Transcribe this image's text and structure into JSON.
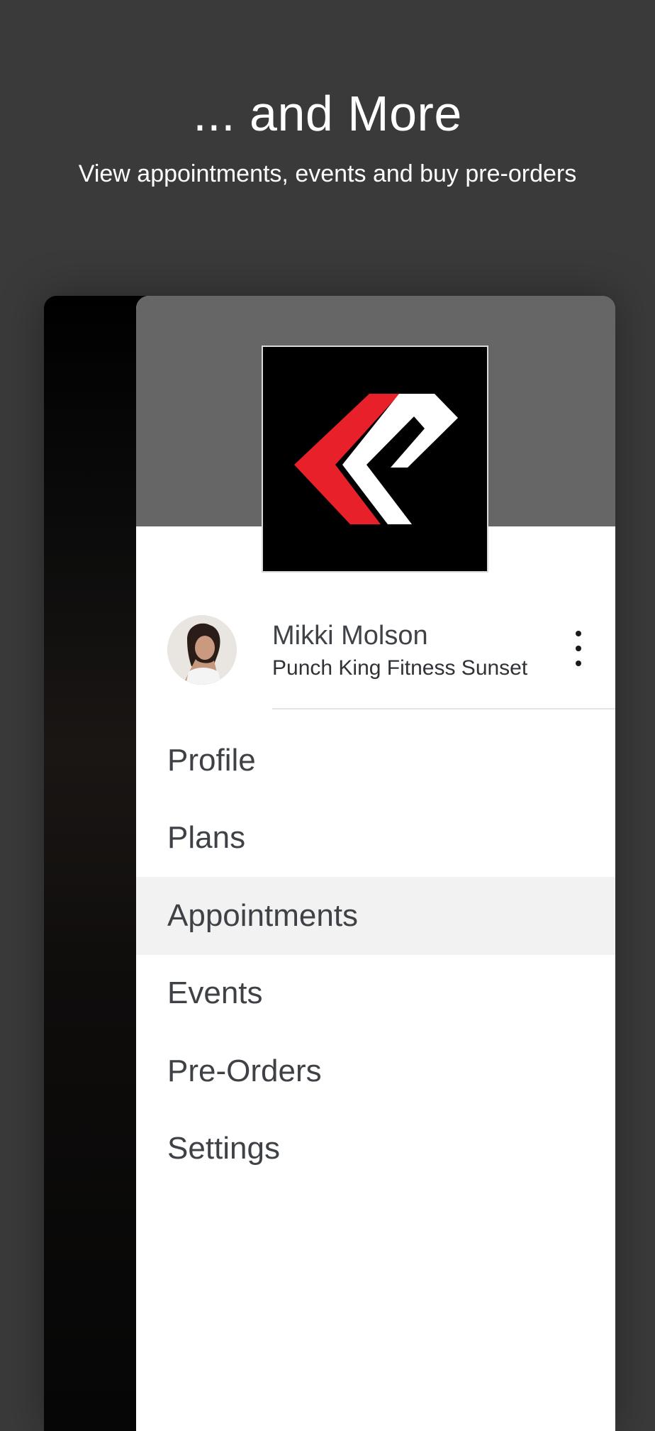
{
  "promo": {
    "title": "... and More",
    "subtitle": "View appointments, events and buy pre-orders"
  },
  "user": {
    "name": "Mikki Molson",
    "gym": "Punch King Fitness Sunset"
  },
  "menu": {
    "items": [
      {
        "label": "Profile"
      },
      {
        "label": "Plans"
      },
      {
        "label": "Appointments",
        "active": true
      },
      {
        "label": "Events"
      },
      {
        "label": "Pre-Orders"
      },
      {
        "label": "Settings"
      }
    ]
  },
  "colors": {
    "background": "#3a3a3a",
    "drawer_header": "#666666",
    "logo_red": "#e8202a",
    "logo_white": "#ffffff",
    "active_item": "#f2f2f2"
  },
  "icons": {
    "menu_more": "more-vertical-icon",
    "logo": "punch-king-logo"
  }
}
